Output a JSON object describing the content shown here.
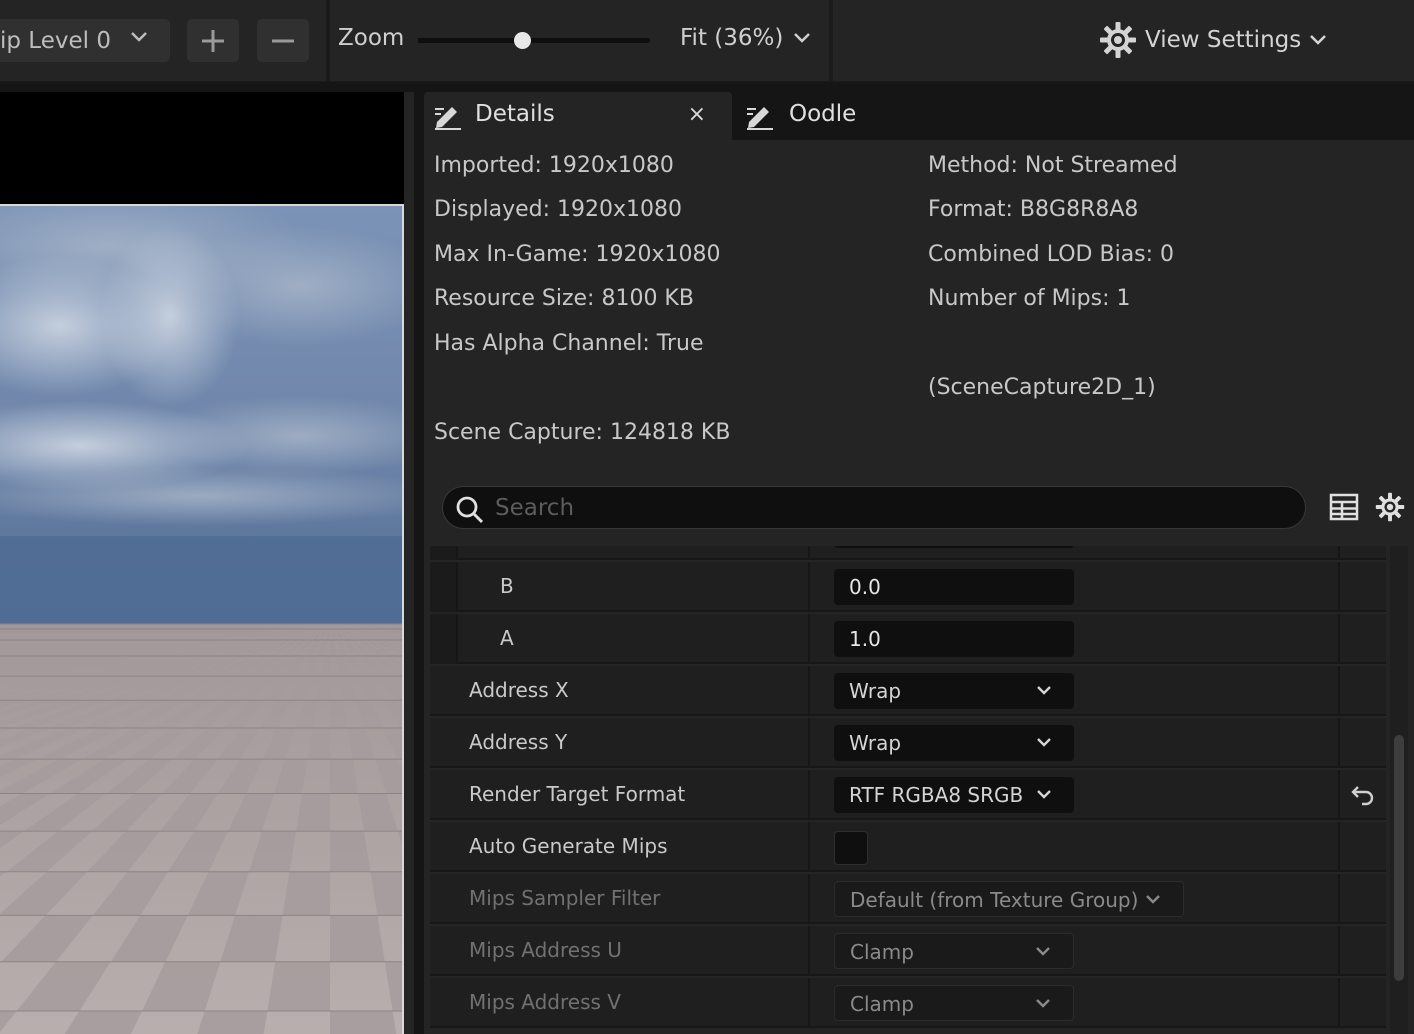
{
  "toolbar": {
    "mip_level": "ip Level 0",
    "zoom_label": "Zoom",
    "zoom_value": 0.45,
    "fit_label": "Fit (36%)",
    "view_settings_label": "View Settings"
  },
  "tabs": [
    {
      "label": "Details",
      "active": true,
      "closable": true,
      "icon": "pencil-icon"
    },
    {
      "label": "Oodle",
      "active": false,
      "closable": false,
      "icon": "pencil-icon"
    }
  ],
  "stats": {
    "imported": "Imported: 1920x1080",
    "displayed": "Displayed: 1920x1080",
    "max_in_game": "Max In-Game: 1920x1080",
    "resource_size": "Resource Size: 8100 KB",
    "has_alpha": "Has Alpha Channel: True",
    "scene_capture": "Scene Capture: 124818 KB",
    "method": "Method: Not Streamed",
    "format": "Format: B8G8R8A8",
    "lod_bias": "Combined LOD Bias: 0",
    "num_mips": "Number of Mips: 1",
    "scene_capture_name": "(SceneCapture2D_1)"
  },
  "search": {
    "placeholder": "Search"
  },
  "properties": {
    "b": {
      "label": "B",
      "value": "0.0"
    },
    "a": {
      "label": "A",
      "value": "1.0"
    },
    "address_x": {
      "label": "Address X",
      "value": "Wrap"
    },
    "address_y": {
      "label": "Address Y",
      "value": "Wrap"
    },
    "render_target_format": {
      "label": "Render Target Format",
      "value": "RTF RGBA8 SRGB"
    },
    "auto_generate_mips": {
      "label": "Auto Generate Mips",
      "checked": false
    },
    "mips_sampler_filter": {
      "label": "Mips Sampler Filter",
      "value": "Default (from Texture Group)"
    },
    "mips_address_u": {
      "label": "Mips Address U",
      "value": "Clamp"
    },
    "mips_address_v": {
      "label": "Mips Address V",
      "value": "Clamp"
    }
  },
  "colors": {
    "panel_bg": "#242424",
    "row_bg": "#1f1f1f",
    "input_bg": "#0f0f0f",
    "sky_top": "#6f88ad",
    "horizon": "#53709a",
    "floor_light": "#b9aeae",
    "floor_dark": "#a69b9c"
  }
}
